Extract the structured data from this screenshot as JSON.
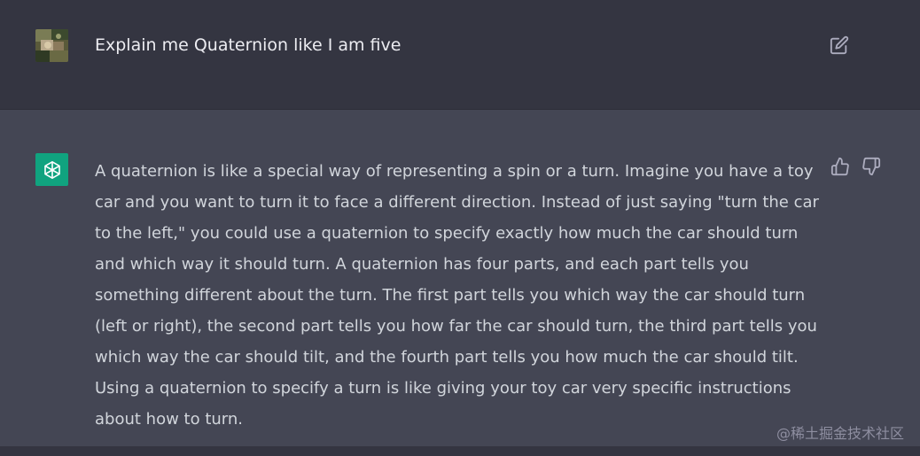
{
  "user_message": {
    "avatar": "user-avatar-image",
    "text": "Explain me Quaternion like I am five",
    "edit_icon": "edit-icon"
  },
  "assistant_message": {
    "avatar": "openai-logo-icon",
    "text": "A quaternion is like a special way of representing a spin or a turn. Imagine you have a toy car and you want to turn it to face a different direction. Instead of just saying \"turn the car to the left,\" you could use a quaternion to specify exactly how much the car should turn and which way it should turn. A quaternion has four parts, and each part tells you something different about the turn. The first part tells you which way the car should turn (left or right), the second part tells you how far the car should turn, the third part tells you which way the car should tilt, and the fourth part tells you how much the car should tilt. Using a quaternion to specify a turn is like giving your toy car very specific instructions about how to turn.",
    "feedback_icons": [
      "thumbs-up-icon",
      "thumbs-down-icon"
    ]
  },
  "watermark": "@稀土掘金技术社区",
  "colors": {
    "user_bg": "#343541",
    "assistant_bg": "#444654",
    "openai_green": "#10a37f",
    "text": "#ececf1"
  }
}
